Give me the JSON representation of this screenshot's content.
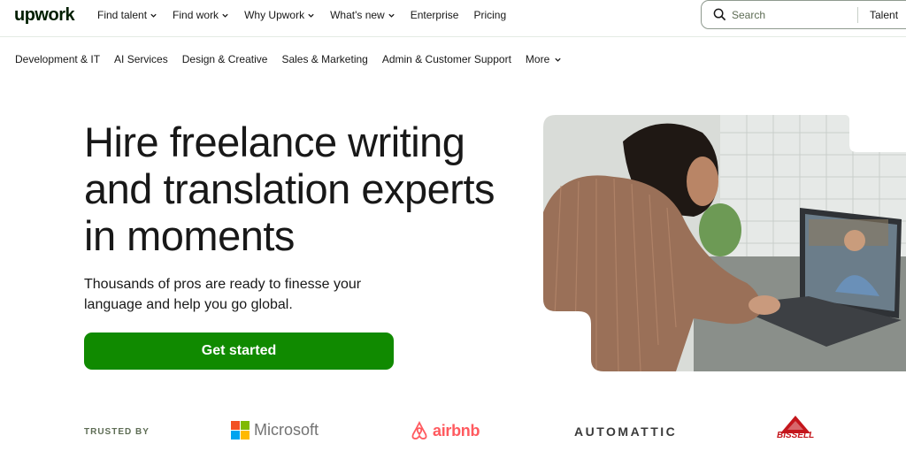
{
  "header": {
    "logo": "upwork",
    "nav": [
      {
        "label": "Find talent",
        "dropdown": true
      },
      {
        "label": "Find work",
        "dropdown": true
      },
      {
        "label": "Why Upwork",
        "dropdown": true
      },
      {
        "label": "What's new",
        "dropdown": true
      },
      {
        "label": "Enterprise",
        "dropdown": false
      },
      {
        "label": "Pricing",
        "dropdown": false
      }
    ],
    "search": {
      "placeholder": "Search",
      "scope": "Talent"
    }
  },
  "categories": {
    "items": [
      "Development & IT",
      "AI Services",
      "Design & Creative",
      "Sales & Marketing",
      "Admin & Customer Support"
    ],
    "more": "More"
  },
  "hero": {
    "title": "Hire freelance writing and translation experts in moments",
    "subtitle": "Thousands of pros are ready to finesse your language and help you go global.",
    "cta": "Get started"
  },
  "trusted": {
    "label": "TRUSTED BY",
    "brands": [
      "Microsoft",
      "airbnb",
      "AUTOMATTIC",
      "BISSELL"
    ]
  },
  "colors": {
    "brand_green": "#108a00",
    "text": "#181818",
    "airbnb": "#ff5a5f",
    "bissell": "#c4161c"
  }
}
